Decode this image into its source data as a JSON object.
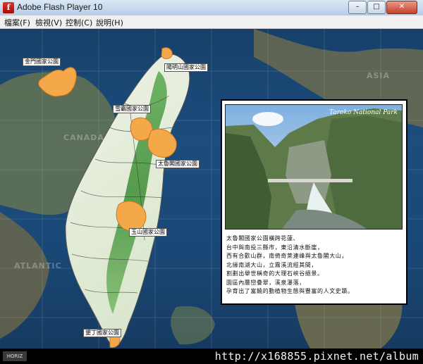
{
  "window": {
    "title": "Adobe Flash Player 10",
    "app_icon_glyph": "f",
    "minimize_glyph": "–",
    "maximize_glyph": "□",
    "close_glyph": "✕"
  },
  "menu": {
    "items": [
      "檔案(F)",
      "檢視(V)",
      "控制(C)",
      "說明(H)"
    ]
  },
  "map": {
    "parks": [
      {
        "label": "金門國家公園"
      },
      {
        "label": "陽明山國家公園"
      },
      {
        "label": "雪霸國家公園"
      },
      {
        "label": "太魯閣國家公園"
      },
      {
        "label": "玉山國家公園"
      },
      {
        "label": "墾丁國家公園"
      }
    ],
    "background_labels": [
      "CANADA",
      "ATLANTIC",
      "ASIA"
    ],
    "colors": {
      "park": "#f5a84a",
      "ocean": "#1c4d7d",
      "land_low": "#f4f7ee",
      "land_high": "#3f8f3a"
    }
  },
  "panel": {
    "photo_caption": "Taroko National Park",
    "description": [
      "太魯閣國家公園橫跨花蓮、",
      "台中與南投三縣市，東沿清水斷崖，",
      "西有合歡山群，南倚奇萊連峰與太魯閣大山，",
      "北緣南湖大山，立霧溪流經其間，",
      "割劃出舉世稱奇的大理石峽谷絕景。",
      "園區內層巒疊翠，溪泉瀑落，",
      "孕育出了富饒的動植物生態與豐富的人文史蹟。"
    ]
  },
  "footer": {
    "url": "http://x168855.pixnet.net/album",
    "left_badge": "HORIZ"
  }
}
